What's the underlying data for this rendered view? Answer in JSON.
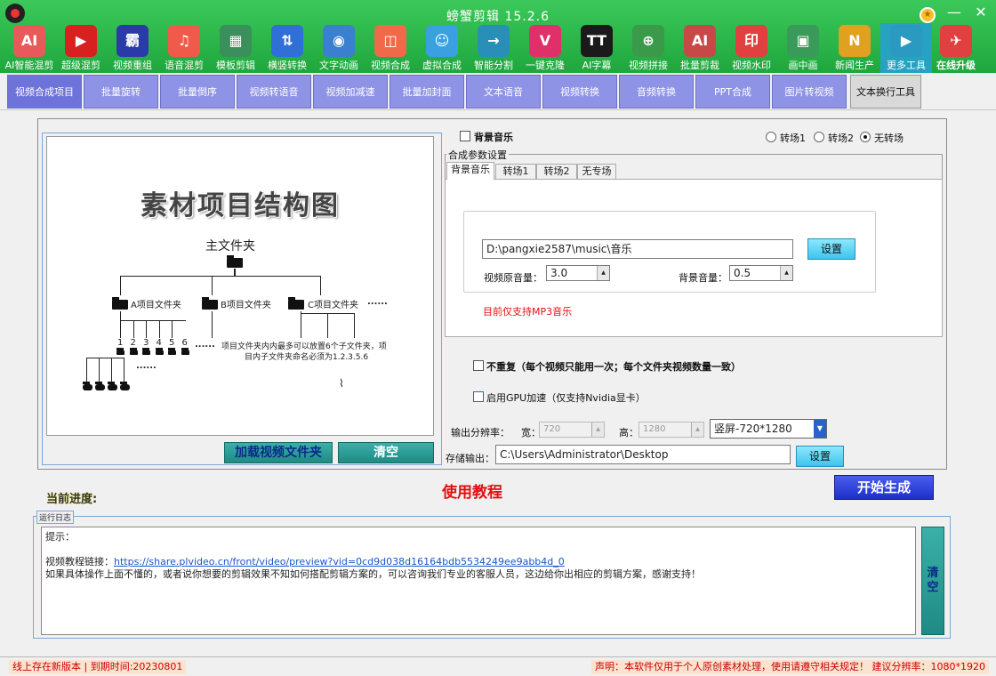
{
  "window": {
    "title": "螃蟹剪辑 15.2.6",
    "minimize": "—",
    "close": "✕"
  },
  "toolbar": [
    {
      "label": "AI智能混剪",
      "glyph": "AI",
      "color": "#e85a5a"
    },
    {
      "label": "超级混剪",
      "glyph": "▶",
      "color": "#d92020"
    },
    {
      "label": "视频重组",
      "glyph": "霸",
      "color": "#2a3aa8"
    },
    {
      "label": "语音混剪",
      "glyph": "♫",
      "color": "#f05a4a"
    },
    {
      "label": "模板剪辑",
      "glyph": "▦",
      "color": "#3a8f5a"
    },
    {
      "label": "横竖转换",
      "glyph": "⇅",
      "color": "#2f6fd6"
    },
    {
      "label": "文字动画",
      "glyph": "◉",
      "color": "#3a7fd0"
    },
    {
      "label": "视频合成",
      "glyph": "◫",
      "color": "#f06a4a"
    },
    {
      "label": "虚拟合成",
      "glyph": "☺",
      "color": "#3aa0e0"
    },
    {
      "label": "智能分割",
      "glyph": "→",
      "color": "#2a8fb8"
    },
    {
      "label": "一键克隆",
      "glyph": "V",
      "color": "#e0306a"
    },
    {
      "label": "AI字幕",
      "glyph": "TT",
      "color": "#1a1a1a"
    },
    {
      "label": "视频拼接",
      "glyph": "⊕",
      "color": "#3a9a4a"
    },
    {
      "label": "批量剪裁",
      "glyph": "AI",
      "color": "#c84848"
    },
    {
      "label": "视频水印",
      "glyph": "印",
      "color": "#e04040"
    },
    {
      "label": "画中画",
      "glyph": "▣",
      "color": "#3a9a5a"
    },
    {
      "label": "新闻生产",
      "glyph": "N",
      "color": "#e0a020"
    },
    {
      "label": "更多工具",
      "glyph": "▶",
      "color": "#2a9ac0"
    },
    {
      "label": "在线升级",
      "glyph": "✈",
      "color": "#e04040"
    }
  ],
  "tabs": [
    "视频合成项目",
    "批量旋转",
    "批量倒序",
    "视频转语音",
    "视频加减速",
    "批量加封面",
    "文本语音",
    "视频转换",
    "音频转换",
    "PPT合成",
    "图片转视频",
    "文本换行工具"
  ],
  "preview": {
    "title": "素材项目结构图",
    "root": "主文件夹",
    "folder_a": "A项目文件夹",
    "folder_b": "B项目文件夹",
    "folder_c": "C项目文件夹",
    "more": "......",
    "nums": [
      "1",
      "2",
      "3",
      "4",
      "5",
      "6"
    ],
    "note1": "项目文件夹内内最多可以放置6个子文件夹，项",
    "note2": "目内子文件夹命名必须为1.2.3.5.6",
    "cursor": "⌇"
  },
  "left_buttons": {
    "load": "加载视频文件夹",
    "clear": "清空"
  },
  "bgm": {
    "checkbox_label": "背景音乐",
    "transitions": [
      "转场1",
      "转场2",
      "无转场"
    ],
    "group_title": "合成参数设置",
    "subtabs": [
      "背景音乐",
      "转场1",
      "转场2",
      "无专场"
    ],
    "path": "D:\\pangxie2587\\music\\音乐",
    "set_button": "设置",
    "orig_volume_label": "视频原音量：",
    "orig_volume": "3.0",
    "bg_volume_label": "背景音量：",
    "bg_volume": "0.5",
    "mp3_note": "目前仅支持MP3音乐"
  },
  "options": {
    "no_repeat": "不重复（每个视频只能用一次；每个文件夹视频数量一致）",
    "gpu": "启用GPU加速（仅支持Nvidia显卡）"
  },
  "output": {
    "resolution_label": "输出分辨率：",
    "width_label": "宽：",
    "width": "720",
    "height_label": "高：",
    "height": "1280",
    "preset": "竖屏-720*1280",
    "save_label": "存储输出：",
    "save_path": "C:\\Users\\Administrator\\Desktop",
    "set_button": "设置"
  },
  "progress_label": "当前进度:",
  "tutorial": "使用教程",
  "start_button": "开始生成",
  "log": {
    "caption": "运行日志",
    "hint": "提示：",
    "link_label": "视频教程链接：",
    "link": "https://share.plvideo.cn/front/video/preview?vid=0cd9d038d16164bdb5534249ee9abb4d_0",
    "message": "如果具体操作上面不懂的，或者说你想要的剪辑效果不知如何搭配剪辑方案的，可以咨询我们专业的客服人员，这边给你出相应的剪辑方案，感谢支持！",
    "clear": "清空"
  },
  "status": {
    "left": "线上存在新版本 | 到期时间:20230801",
    "right": "声明：本软件仅用于个人原创素材处理，使用请遵守相关规定！ 建议分辨率：1080*1920"
  }
}
